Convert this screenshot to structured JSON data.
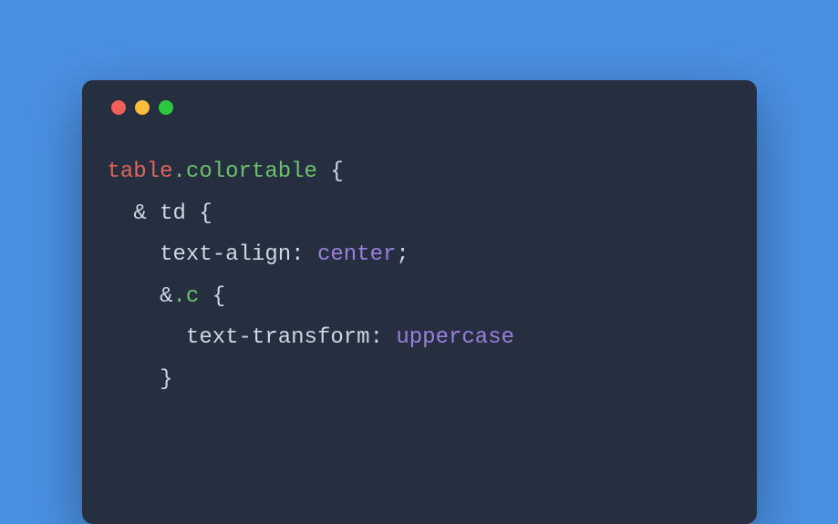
{
  "window": {
    "colors": {
      "close": "#f25f58",
      "minimize": "#fbbe3c",
      "zoom": "#2ac940",
      "background": "#252f3f",
      "page": "#4a90e2"
    }
  },
  "code": {
    "language": "css-nesting",
    "indent": "  ",
    "lines": [
      {
        "indent": 0,
        "tokens": [
          {
            "t": "table",
            "c": "tag"
          },
          {
            "t": ".colortable",
            "c": "class"
          },
          {
            "t": " {",
            "c": "brace"
          }
        ]
      },
      {
        "indent": 1,
        "tokens": [
          {
            "t": "&",
            "c": "amp"
          },
          {
            "t": " ",
            "c": "punct"
          },
          {
            "t": "td",
            "c": "elem"
          },
          {
            "t": " {",
            "c": "brace"
          }
        ]
      },
      {
        "indent": 2,
        "tokens": [
          {
            "t": "text-align",
            "c": "prop"
          },
          {
            "t": ": ",
            "c": "punct"
          },
          {
            "t": "center",
            "c": "value"
          },
          {
            "t": ";",
            "c": "punct"
          }
        ]
      },
      {
        "indent": 0,
        "tokens": [
          {
            "t": "",
            "c": "punct"
          }
        ]
      },
      {
        "indent": 2,
        "tokens": [
          {
            "t": "&",
            "c": "amp"
          },
          {
            "t": ".c",
            "c": "class"
          },
          {
            "t": " {",
            "c": "brace"
          }
        ]
      },
      {
        "indent": 3,
        "tokens": [
          {
            "t": "text-transform",
            "c": "prop"
          },
          {
            "t": ": ",
            "c": "punct"
          },
          {
            "t": "uppercase",
            "c": "value"
          }
        ]
      },
      {
        "indent": 2,
        "tokens": [
          {
            "t": "}",
            "c": "brace"
          }
        ]
      }
    ]
  }
}
